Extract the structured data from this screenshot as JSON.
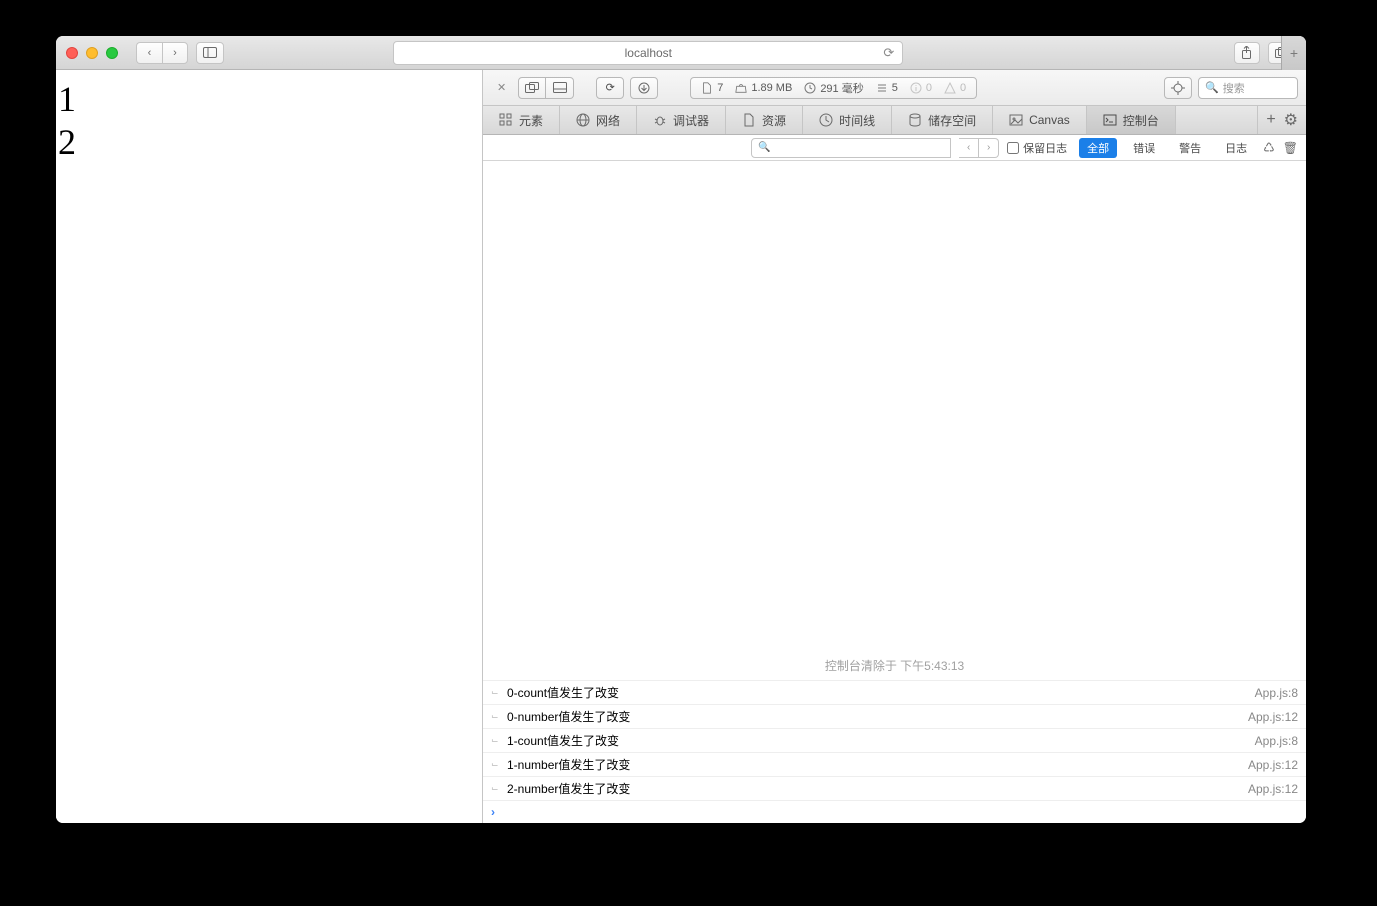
{
  "addressbar": {
    "url": "localhost"
  },
  "newtab_plus": "+",
  "page_content": {
    "line1": "1",
    "line2": "2"
  },
  "devtools": {
    "search_placeholder": "搜索",
    "stats": {
      "files": "7",
      "size": "1.89 MB",
      "time": "291 毫秒",
      "logs": "5",
      "info": "0",
      "warn": "0"
    },
    "tabs": {
      "elements": "元素",
      "network": "网络",
      "debugger": "调试器",
      "resources": "资源",
      "timeline": "时间线",
      "storage": "储存空间",
      "canvas": "Canvas",
      "console": "控制台"
    },
    "filter": {
      "keep_log": "保留日志",
      "all": "全部",
      "error": "错误",
      "warning": "警告",
      "log": "日志"
    },
    "clear_message": "控制台清除于 下午5:43:13",
    "logs": [
      {
        "msg": "0-count值发生了改变",
        "src": "App.js:8"
      },
      {
        "msg": "0-number值发生了改变",
        "src": "App.js:12"
      },
      {
        "msg": "1-count值发生了改变",
        "src": "App.js:8"
      },
      {
        "msg": "1-number值发生了改变",
        "src": "App.js:12"
      },
      {
        "msg": "2-number值发生了改变",
        "src": "App.js:12"
      }
    ]
  }
}
